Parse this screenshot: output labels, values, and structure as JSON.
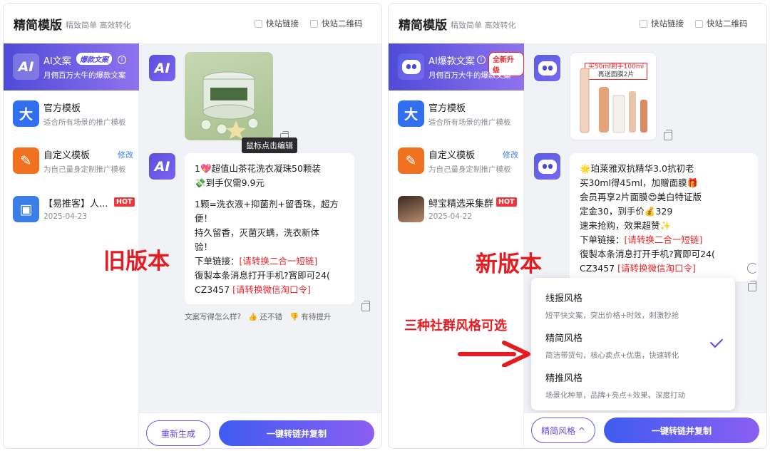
{
  "header": {
    "title": "精简模版",
    "subtitle": "精致简单 高效转化",
    "quick_link": "快站链接",
    "quick_qr": "快站二维码"
  },
  "left": {
    "sidebar": [
      {
        "name": "AI文案",
        "badge": "爆款文案",
        "desc": "月佣百万大牛的爆款文案",
        "icon": "AI"
      },
      {
        "name": "官方模板",
        "desc": "适合所有场景的推广模板",
        "icon": "大"
      },
      {
        "name": "自定义模板",
        "desc": "为自己量身定制推广模板",
        "edit": "修改",
        "icon": "edit-icon"
      },
      {
        "name": "【易推客】人...",
        "hot": "HOT",
        "date": "2025-04-23",
        "icon": "box-icon"
      }
    ],
    "tooltip": "鼠标点击编辑",
    "message_lines": [
      "1💖超值山茶花洗衣凝珠50颗装",
      "💸到手仅需9.9元",
      "",
      "1颗=洗衣液+抑菌剂+留香珠，超方",
      "便！",
      "持久留香，灭菌灭螨，洗衣新体",
      "验！"
    ],
    "link_label": "下单链接：",
    "link_red": "[请转换二合一短链]",
    "copy_line": "復製本条消息打开手机?寳即可24(",
    "code": "CZ3457",
    "code_red": "[请转换微信淘口令]",
    "feedback": {
      "question": "文案写得怎么样?",
      "good": "还不错",
      "improve": "有待提升"
    },
    "btn_regen": "重新生成",
    "btn_copy": "一键转链并复制",
    "big_label": "旧版本"
  },
  "right": {
    "sidebar": [
      {
        "name": "AI爆款文案",
        "badge": "全新升级",
        "desc": "月佣百万大牛的爆款文案",
        "icon": "robot-icon"
      },
      {
        "name": "官方模板",
        "desc": "适合所有场景的推广模板",
        "icon": "大"
      },
      {
        "name": "自定义模板",
        "desc": "为自己量身定制推广模板",
        "edit": "修改",
        "icon": "edit-icon"
      },
      {
        "name": "鲟宝精选采集群",
        "hot": "HOT",
        "date": "2025-04-22",
        "icon": "photo-avatar"
      }
    ],
    "product_img_text": [
      "买50ml到手100ml",
      "再送面膜2片"
    ],
    "message_lines": [
      "🌟珀莱雅双抗精华3.0抗初老",
      "买30ml得45ml，加赠面膜🎁",
      "会员再享2片面膜😍美白特证版",
      "定金30，到手价💰329",
      "速来抢购，效果超赞✨"
    ],
    "link_label": "下单链接：",
    "link_red": "[请转换二合一短链]",
    "copy_line": "復製本条消息打开手机?寳即可24(",
    "code": "CZ3457",
    "code_red": "[请转换微信淘口令]",
    "styles": [
      {
        "title": "线报风格",
        "desc": "短平快文案，突出价格+时效，刺激秒抢"
      },
      {
        "title": "精简风格",
        "desc": "简洁带货句，核心卖点+优惠，快速转化",
        "selected": true
      },
      {
        "title": "精推风格",
        "desc": "场景化种草，品牌+亮点+效果，深度打动"
      }
    ],
    "style_btn": "精简风格 ^",
    "btn_copy": "一键转链并复制",
    "big_label": "新版本",
    "callout": "三种社群风格可选"
  },
  "colors": {
    "accent": "#5b48e0",
    "red": "#e41d22",
    "link": "#3d7bf2"
  }
}
